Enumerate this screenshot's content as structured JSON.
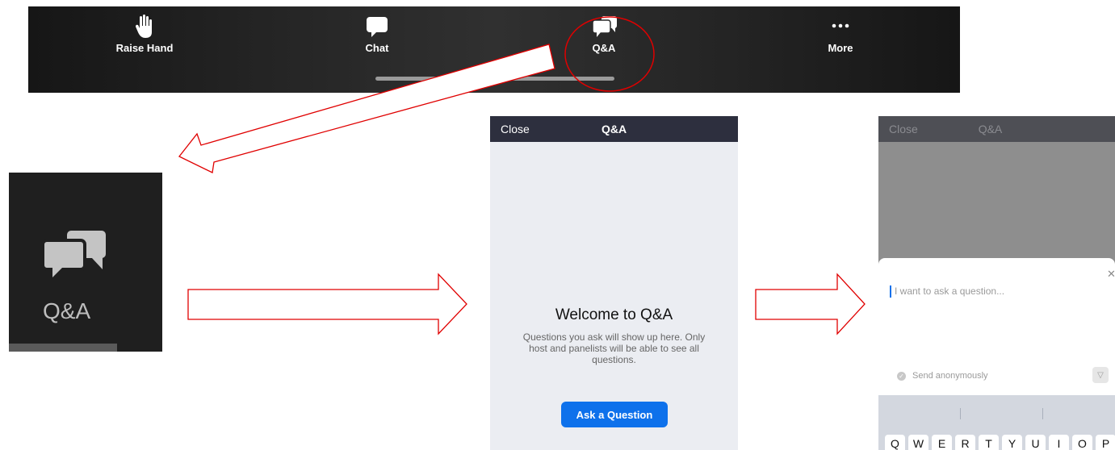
{
  "toolbar": {
    "items": [
      {
        "label": "Raise Hand",
        "icon": "raise-hand-icon"
      },
      {
        "label": "Chat",
        "icon": "chat-icon"
      },
      {
        "label": "Q&A",
        "icon": "qa-icon"
      },
      {
        "label": "More",
        "icon": "more-icon"
      }
    ]
  },
  "zoom_tile": {
    "label": "Q&A",
    "icon": "qa-icon"
  },
  "qa_panel": {
    "close": "Close",
    "title": "Q&A",
    "welcome": "Welcome to Q&A",
    "description": "Questions you ask will show up here. Only host and panelists will be able to see all questions.",
    "ask_button": "Ask a Question"
  },
  "compose_panel": {
    "close": "Close",
    "title": "Q&A",
    "placeholder": "I want to ask a question...",
    "anonymous": "Send anonymously",
    "keys": [
      "Q",
      "W",
      "E",
      "R",
      "T",
      "Y",
      "U",
      "I",
      "O",
      "P"
    ]
  },
  "colors": {
    "annotation_red": "#e00000",
    "accent_blue": "#0e71eb",
    "header_dark": "#2d2f3e"
  }
}
